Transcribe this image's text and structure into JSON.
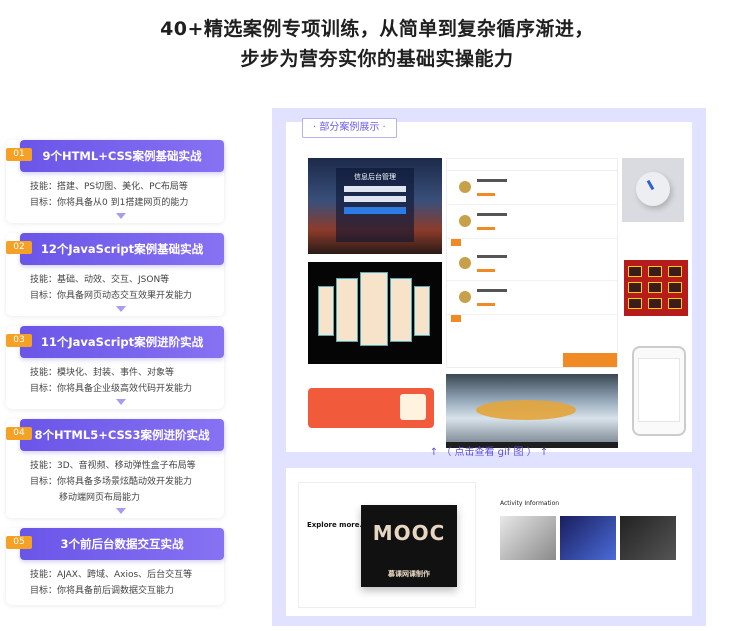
{
  "headline": {
    "line1": "40+精选案例专项训练，从简单到复杂循序渐进，",
    "line2": "步步为营夯实你的基础实操能力"
  },
  "steps": [
    {
      "num": "01",
      "title": "9个HTML+CSS案例基础实战",
      "lines": [
        "技能：搭建、PS切图、美化、PC布局等",
        "目标：你将具备从0 到1搭建网页的能力"
      ]
    },
    {
      "num": "02",
      "title": "12个JavaScript案例基础实战",
      "lines": [
        "技能：基础、动效、交互、JSON等",
        "目标：你具备网页动态交互效果开发能力"
      ]
    },
    {
      "num": "03",
      "title": "11个JavaScript案例进阶实战",
      "lines": [
        "技能：模块化、封装、事件、对象等",
        "目标：你将具备企业级高效代码开发能力"
      ]
    },
    {
      "num": "04",
      "title": "8个HTML5+CSS3案例进阶实战",
      "lines": [
        "技能：3D、音视频、移动弹性盒子布局等",
        "目标：你将具备多场景炫酷动效开发能力",
        "移动端网页布局能力"
      ]
    },
    {
      "num": "05",
      "title": "3个前后台数据交互实战",
      "lines": [
        "技能：AJAX、跨域、Axios、后台交互等",
        "目标：你将具备前后调数据交互能力"
      ]
    }
  ],
  "showcase": {
    "tag": "· 部分案例展示 ·",
    "gif_link": "（ 点击查看 gif 图 ）",
    "login_title": "信息后台管理",
    "explore_title": "Explore more.",
    "mooc_logo": "MOOC",
    "mooc_subtitle": "慕课网课制作",
    "activity_title": "Activity Information"
  }
}
